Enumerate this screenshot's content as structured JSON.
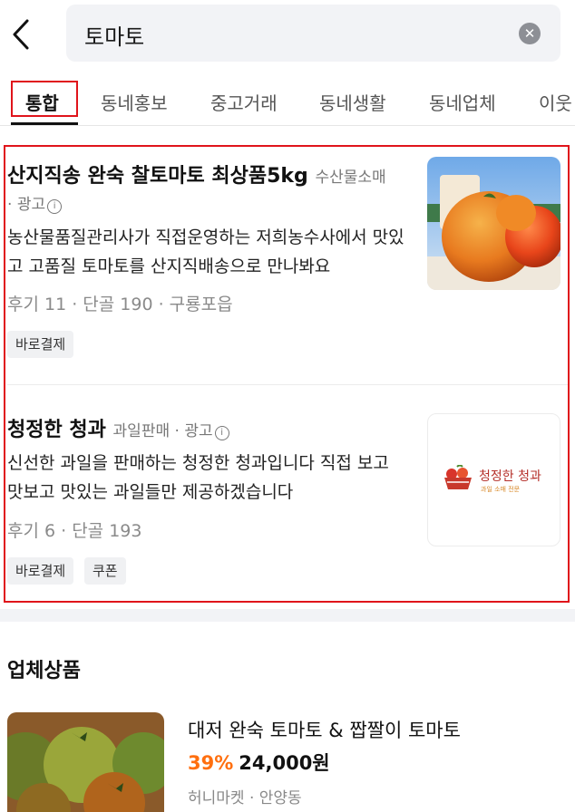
{
  "search": {
    "query": "토마토"
  },
  "tabs": [
    {
      "label": "통합",
      "active": true
    },
    {
      "label": "동네홍보"
    },
    {
      "label": "중고거래"
    },
    {
      "label": "동네생활"
    },
    {
      "label": "동네업체"
    },
    {
      "label": "이웃"
    }
  ],
  "ads": [
    {
      "title": "산지직송 완숙 찰토마토 최상품5kg",
      "category": "수산물소매",
      "ad_label": "광고",
      "description": "농산물품질관리사가 직접운영하는 저희농수사에서 맛있고 고품질 토마토를 산지직배송으로 만나봐요",
      "stats": "후기 11 · 단골 190 · 구룡포읍",
      "tags": [
        "바로결제"
      ],
      "thumb_icon": "tomato-photo"
    },
    {
      "title": "청정한 청과",
      "category": "과일판매",
      "ad_label": "광고",
      "description": "신선한 과일을 판매하는 청정한 청과입니다 직접 보고 맛보고 맛있는 과일들만 제공하겠습니다",
      "stats": "후기 6 · 단골 193",
      "tags": [
        "바로결제",
        "쿠폰"
      ],
      "logo": {
        "name": "청정한 청과",
        "sub": "과일 소매 전문"
      }
    }
  ],
  "section": {
    "title": "업체상품",
    "product": {
      "name": "대저 완숙 토마토 & 짭짤이 토마토",
      "discount": "39%",
      "price": "24,000원",
      "seller": "허니마켓 · 안양동"
    }
  },
  "colors": {
    "accent": "#ff6f0f",
    "annotation_red": "#e0141b"
  }
}
